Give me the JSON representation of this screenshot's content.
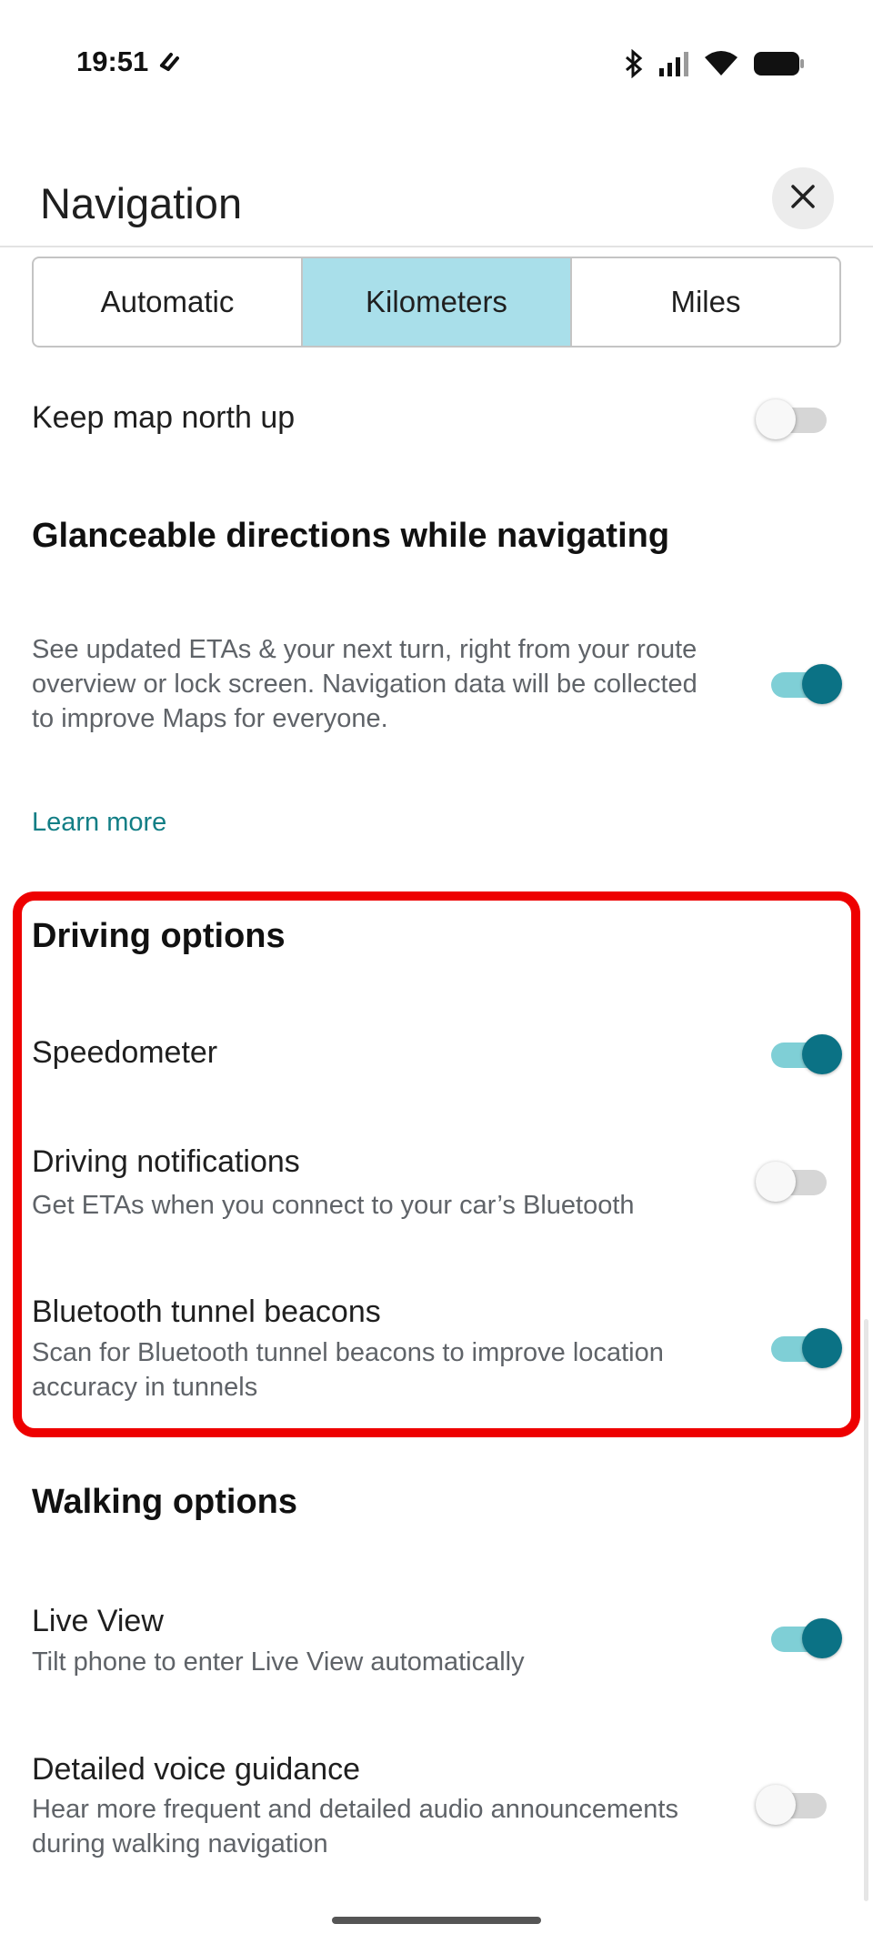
{
  "status_bar": {
    "time": "19:51"
  },
  "header": {
    "title": "Navigation"
  },
  "units": {
    "options": [
      "Automatic",
      "Kilometers",
      "Miles"
    ],
    "selected": "Kilometers"
  },
  "settings": {
    "north_up": {
      "title": "Keep map north up",
      "enabled": false
    },
    "glanceable": {
      "title": "Glanceable directions while navigating",
      "description": "See updated ETAs & your next turn, right from your route overview or lock screen. Navigation data will be collected to improve Maps for everyone.",
      "enabled": true,
      "learn_more": "Learn more"
    },
    "driving": {
      "title": "Driving options",
      "speedometer": {
        "title": "Speedometer",
        "enabled": true
      },
      "notifications": {
        "title": "Driving notifications",
        "description": "Get ETAs when you connect to your car’s Bluetooth",
        "enabled": false
      },
      "tunnel_beacons": {
        "title": "Bluetooth tunnel beacons",
        "description": "Scan for Bluetooth tunnel beacons to improve location accuracy in tunnels",
        "enabled": true
      }
    },
    "walking": {
      "title": "Walking options",
      "live_view": {
        "title": "Live View",
        "description": "Tilt phone to enter Live View automatically",
        "enabled": true
      },
      "voice_guidance": {
        "title": "Detailed voice guidance",
        "description": "Hear more frequent and detailed audio announcements during walking navigation",
        "enabled": false
      }
    }
  },
  "colors": {
    "accent": "#0b7285",
    "accent_track": "#7fcfd6",
    "selected_segment": "#a9dfea",
    "link": "#127e85",
    "highlight": "#ee0000"
  }
}
